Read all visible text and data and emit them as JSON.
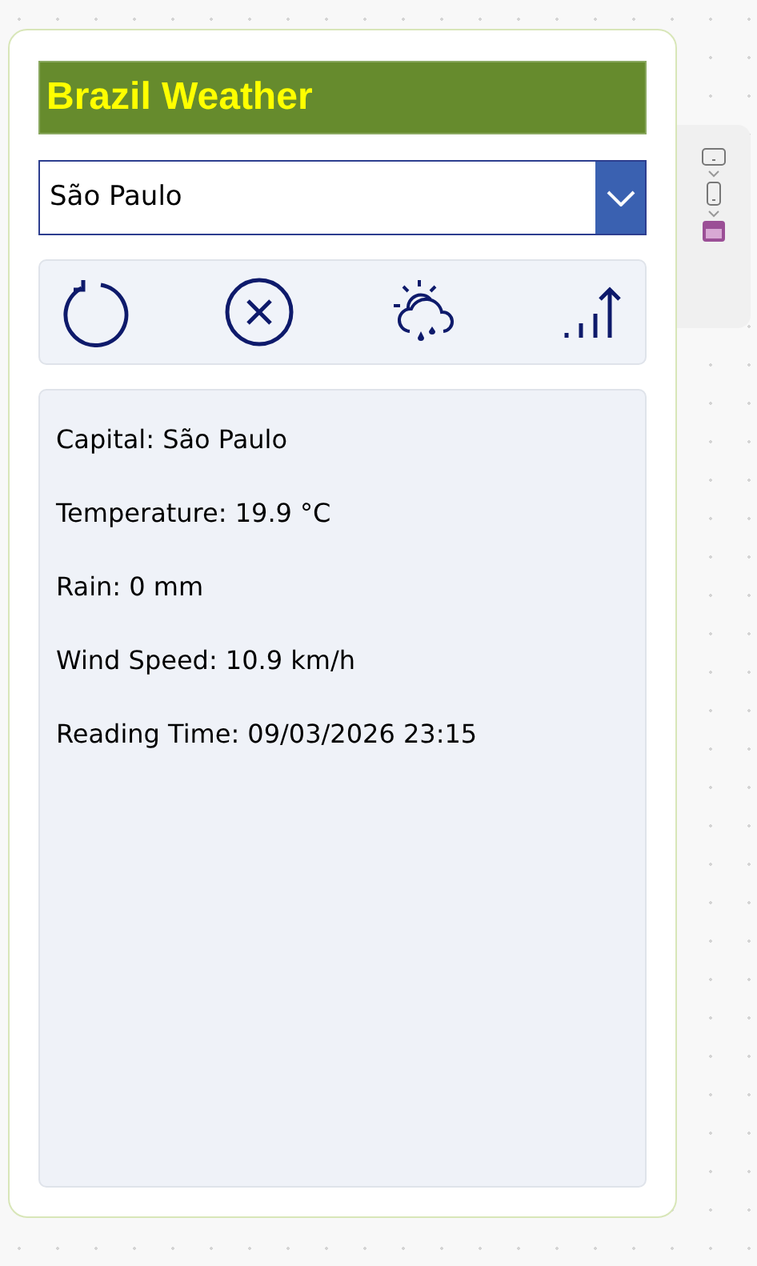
{
  "title": "Brazil Weather",
  "city_dropdown": {
    "value": "São Paulo"
  },
  "details": [
    "Capital: São Paulo",
    "Temperature: 19.9 °C",
    "Rain: 0 mm",
    "Wind Speed: 10.9 km/h",
    "Reading Time: 09/03/2026 23:15"
  ]
}
